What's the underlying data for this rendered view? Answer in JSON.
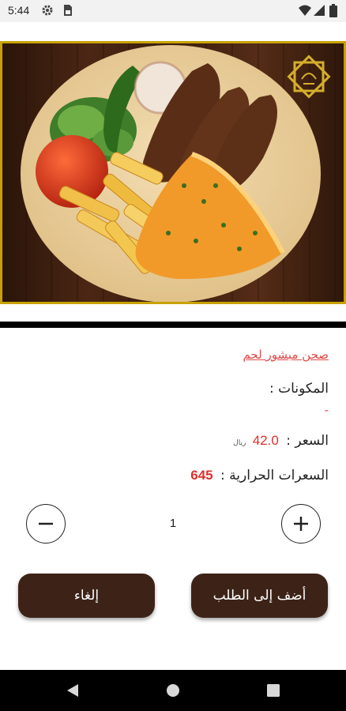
{
  "status_bar": {
    "time": "5:44"
  },
  "product": {
    "name": "صحن مبشور لحم",
    "ingredients_label": "المكونات :",
    "ingredients_value": "-",
    "price_label": "السعر :",
    "price": "42.0",
    "currency": "ريال",
    "calories_label": "السعرات الحرارية :",
    "calories": "645"
  },
  "quantity": {
    "value": "1"
  },
  "actions": {
    "add_label": "أضف إلى الطلب",
    "cancel_label": "إلغاء"
  },
  "colors": {
    "accent_red": "#e0302b",
    "button_brown": "#3d2317",
    "frame_gold": "#c9a100"
  },
  "icons": [
    "settings-icon",
    "sim-card-icon",
    "wifi-icon",
    "signal-icon",
    "battery-icon",
    "logo-emblem-icon",
    "minus-icon",
    "plus-icon",
    "back-icon",
    "home-icon",
    "recents-icon"
  ]
}
